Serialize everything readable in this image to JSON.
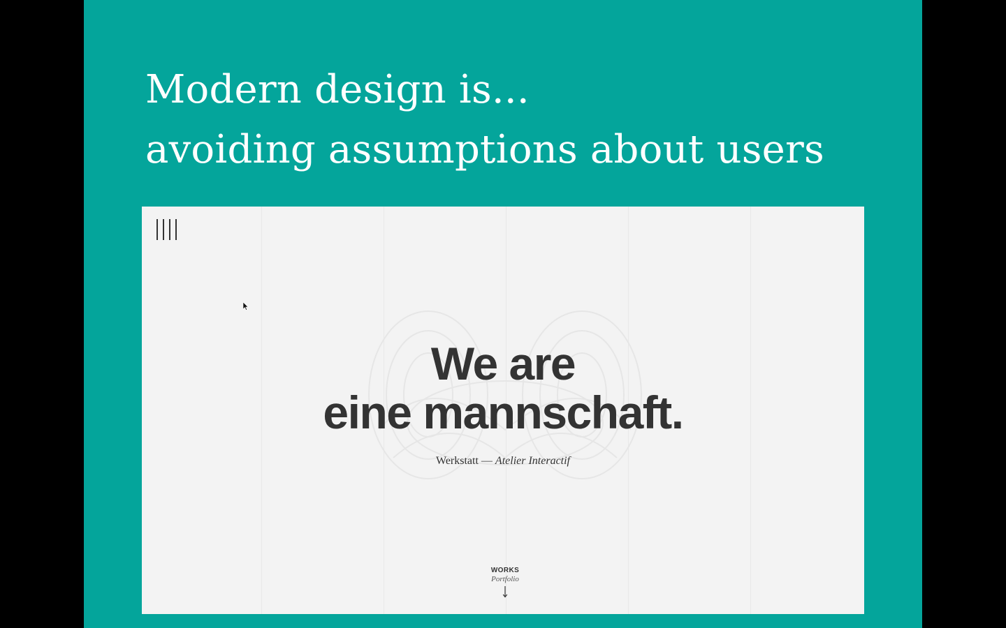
{
  "slide": {
    "background": "#04a59b",
    "title_line_1": "Modern design is...",
    "title_line_2": "avoiding assumptions about users"
  },
  "website": {
    "menu_icon": "menu-bars-icon",
    "headline_line_1": "We are",
    "headline_line_2": "eine mannschaft.",
    "sub_prefix": "Werkstatt —",
    "sub_italic": "Atelier Interactif",
    "works_title": "WORKS",
    "works_subtitle": "Portfolio",
    "works_arrow": "down-arrow-icon"
  }
}
